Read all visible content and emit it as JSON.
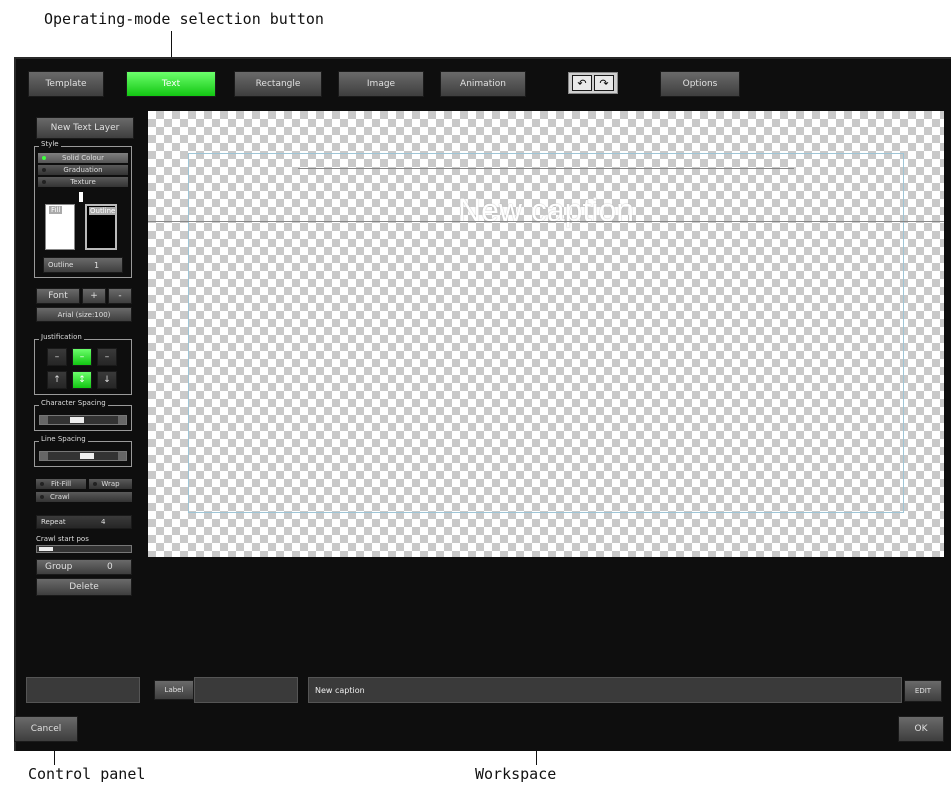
{
  "annotations": {
    "mode_button_callout": "Operating-mode selection button",
    "control_panel_callout": "Control panel",
    "workspace_callout": "Workspace"
  },
  "toolbar": {
    "modes": [
      "Template",
      "Text",
      "Rectangle",
      "Image",
      "Animation"
    ],
    "active_mode": "Text",
    "undo_icon": "undo-icon",
    "redo_icon": "redo-icon",
    "options_label": "Options"
  },
  "control_panel": {
    "new_text_layer": "New Text Layer",
    "style_label": "Style",
    "style_options": [
      "Solid Colour",
      "Graduation",
      "Texture"
    ],
    "style_selected": "Solid Colour",
    "fill_label": "Fill",
    "outline_label": "Outline",
    "fill_color": "#ffffff",
    "outline_color": "#000000",
    "outline_spin_label": "Outline",
    "outline_value": "1",
    "font_label": "Font",
    "font_plus": "+",
    "font_minus": "-",
    "font_name": "Arial (size:100)",
    "justification_label": "Justification",
    "character_spacing_label": "Character Spacing",
    "line_spacing_label": "Line Spacing",
    "fit_fill_label": "Fit-Fill",
    "wrap_label": "Wrap",
    "crawl_label": "Crawl",
    "repeat_label": "Repeat",
    "repeat_value": "4",
    "crawl_start_label": "Crawl start pos",
    "group_label": "Group",
    "group_value": "0",
    "delete_label": "Delete"
  },
  "workspace": {
    "caption_text": "New caption"
  },
  "bottom": {
    "label_button": "Label",
    "caption_field_value": "New caption",
    "edit_button": "EDIT",
    "cancel_label": "Cancel",
    "ok_label": "OK"
  },
  "colors": {
    "accent_green": "#22dd22",
    "background": "#0e0e0e",
    "guide_line": "#9ec5d6"
  }
}
